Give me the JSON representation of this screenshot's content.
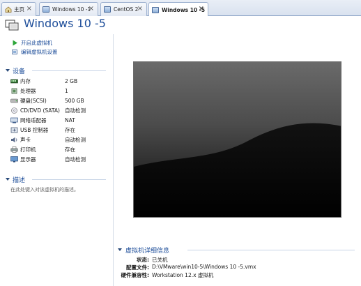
{
  "tabs": [
    {
      "label": "主页",
      "icon": "home-icon"
    },
    {
      "label": "Windows 10 -1",
      "icon": "vm-icon"
    },
    {
      "label": "CentOS 2",
      "icon": "vm-icon"
    },
    {
      "label": "Windows 10 -5",
      "icon": "vm-icon",
      "active": true
    }
  ],
  "header": {
    "title": "Windows 10 -5"
  },
  "actions": [
    {
      "label": "开启此虚拟机",
      "icon": "play-icon"
    },
    {
      "label": "编辑虚拟机设置",
      "icon": "edit-settings-icon"
    }
  ],
  "devices": {
    "heading": "设备",
    "items": [
      {
        "name": "内存",
        "value": "2 GB",
        "icon": "memory-icon"
      },
      {
        "name": "处理器",
        "value": "1",
        "icon": "cpu-icon"
      },
      {
        "name": "硬盘(SCSI)",
        "value": "500 GB",
        "icon": "hard-disk-icon"
      },
      {
        "name": "CD/DVD (SATA)",
        "value": "自动检测",
        "icon": "cd-dvd-icon"
      },
      {
        "name": "网络适配器",
        "value": "NAT",
        "icon": "network-adapter-icon"
      },
      {
        "name": "USB 控制器",
        "value": "存在",
        "icon": "usb-icon"
      },
      {
        "name": "声卡",
        "value": "自动检测",
        "icon": "sound-card-icon"
      },
      {
        "name": "打印机",
        "value": "存在",
        "icon": "printer-icon"
      },
      {
        "name": "显示器",
        "value": "自动检测",
        "icon": "display-icon"
      }
    ]
  },
  "description": {
    "heading": "描述",
    "placeholder": "在此处键入对该虚拟机的描述。"
  },
  "details": {
    "heading": "虚拟机详细信息",
    "rows": [
      {
        "key": "状态:",
        "value": "已关机"
      },
      {
        "key": "配置文件:",
        "value": "D:\\VMware\\win10-5\\Windows 10 -5.vmx"
      },
      {
        "key": "硬件兼容性:",
        "value": "Workstation 12.x 虚拟机"
      }
    ]
  },
  "colors": {
    "accent": "#1e4e9a",
    "tab_border": "#9cb0cf"
  }
}
